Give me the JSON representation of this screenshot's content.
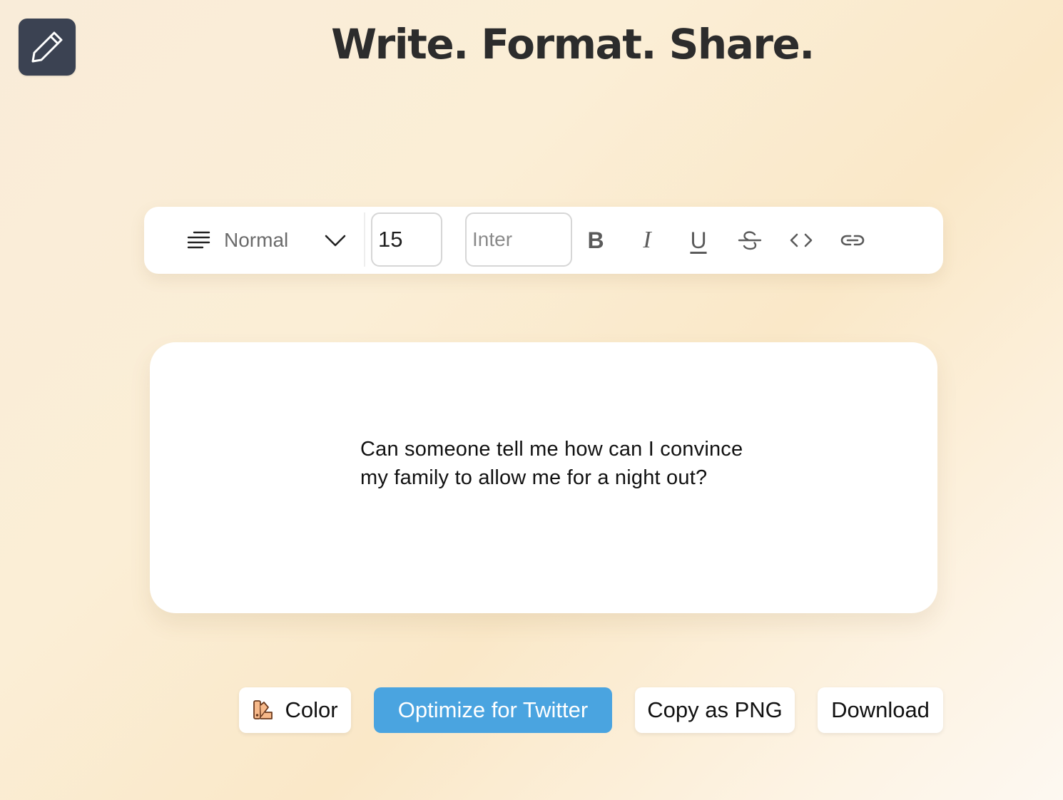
{
  "app": {
    "headline": "Write. Format. Share."
  },
  "icons": {
    "logo": "pencil-icon",
    "block_type": "text-lines-icon",
    "dropdown": "chevron-down-icon",
    "strikethrough": "strikethrough-icon",
    "code": "code-icon",
    "link": "link-icon",
    "color": "palette-icon"
  },
  "toolbar": {
    "block_type_label": "Normal",
    "font_size_value": "15",
    "font_family_placeholder": "Inter",
    "bold_label": "B",
    "italic_label": "I",
    "underline_label": "U"
  },
  "editor": {
    "content": "Can someone tell me how can I convince my family to allow me for a night out?"
  },
  "actions": {
    "color_label": "Color",
    "optimize_label": "Optimize for Twitter",
    "copy_label": "Copy as PNG",
    "download_label": "Download"
  },
  "colors": {
    "accent": "#4aa4e0",
    "logo_bg": "#3b4252",
    "background": "#fbeed6"
  }
}
